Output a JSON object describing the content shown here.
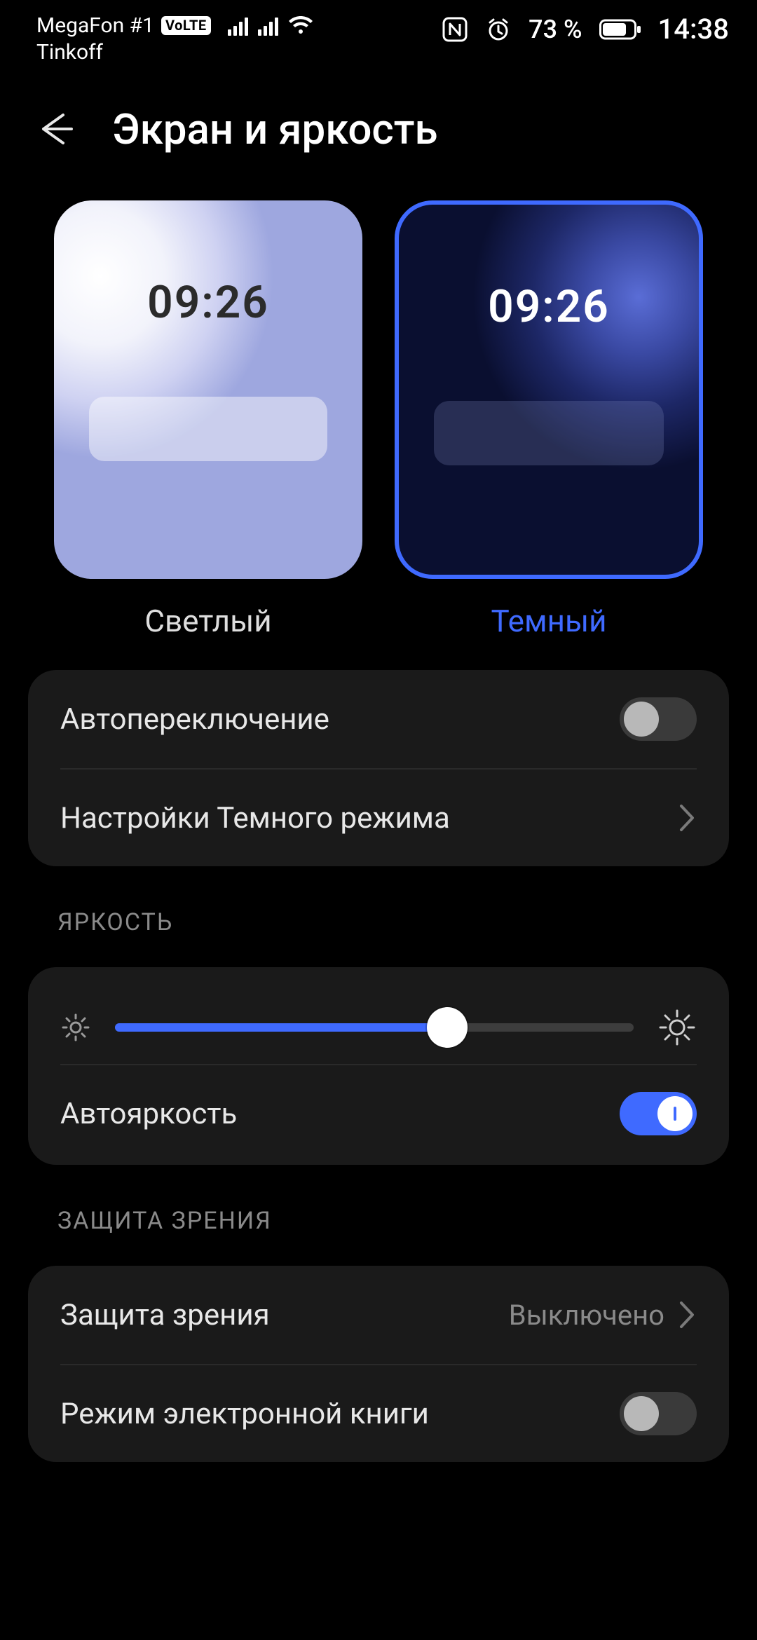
{
  "status": {
    "carrier1": "MegaFon #1",
    "volte": "VoLTE",
    "carrier2": "Tinkoff",
    "battery_pct": "73 %",
    "time": "14:38"
  },
  "header": {
    "title": "Экран и яркость"
  },
  "themes": {
    "preview_time": "09:26",
    "light_label": "Светлый",
    "dark_label": "Темный",
    "selected": "dark"
  },
  "mode_card": {
    "auto_switch_label": "Автопереключение",
    "auto_switch_on": false,
    "dark_settings_label": "Настройки Темного режима"
  },
  "brightness": {
    "section_title": "ЯРКОСТЬ",
    "slider_pct": 64,
    "auto_label": "Автояркость",
    "auto_on": true
  },
  "eye": {
    "section_title": "ЗАЩИТА ЗРЕНИЯ",
    "eye_comfort_label": "Защита зрения",
    "eye_comfort_value": "Выключено",
    "ebook_label": "Режим электронной книги",
    "ebook_on": false
  },
  "colors": {
    "accent": "#3f6aff"
  }
}
